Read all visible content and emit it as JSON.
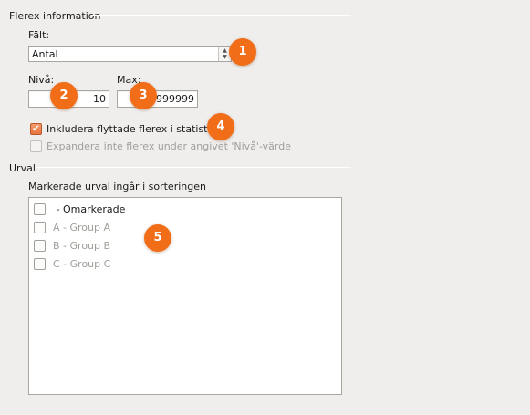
{
  "flerex": {
    "section_title": "Flerex information",
    "field_label": "Fält:",
    "field_value": "Antal",
    "level_label": "Nivå:",
    "level_value": "10",
    "max_label": "Max:",
    "max_value": "999999",
    "include_moved_label": "Inkludera flyttade flerex i statistiken",
    "include_moved_checked": true,
    "expand_label": "Expandera inte flerex under angivet 'Nivå'-värde",
    "expand_checked": false,
    "expand_enabled": false
  },
  "selection": {
    "section_title": "Urval",
    "list_label": "Markerade urval ingår i sorteringen",
    "items": [
      {
        "label": " - Omarkerade",
        "checked": false,
        "enabled": true
      },
      {
        "label": "A - Group A",
        "checked": false,
        "enabled": false
      },
      {
        "label": "B - Group B",
        "checked": false,
        "enabled": false
      },
      {
        "label": "C - Group C",
        "checked": false,
        "enabled": false
      }
    ]
  },
  "badges": [
    "1",
    "2",
    "3",
    "4",
    "5"
  ],
  "colors": {
    "badge": "#f26d18",
    "checkbox_checked": "#e9743e",
    "background": "#efeeed"
  }
}
